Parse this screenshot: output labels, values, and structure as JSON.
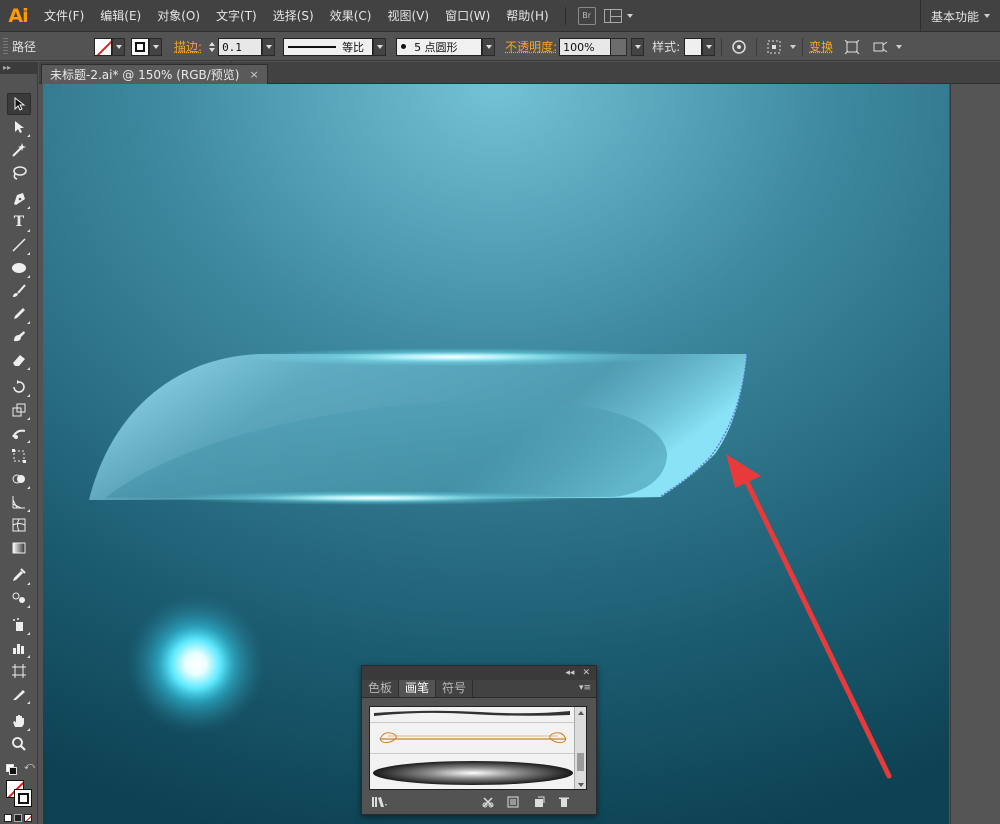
{
  "app": {
    "logo": "Ai",
    "menu": [
      "文件(F)",
      "编辑(E)",
      "对象(O)",
      "文字(T)",
      "选择(S)",
      "效果(C)",
      "视图(V)",
      "窗口(W)",
      "帮助(H)"
    ],
    "bridge_label": "Br",
    "workspace": "基本功能"
  },
  "control": {
    "object_type": "路径",
    "stroke_label": "描边:",
    "stroke_weight": "0.1 pt",
    "stroke_profile": "等比",
    "brush_def": "5 点圆形",
    "opacity_label": "不透明度:",
    "opacity_value": "100%",
    "style_label": "样式:",
    "transform_label": "变换"
  },
  "document": {
    "tab_title": "未标题-2.ai* @ 150% (RGB/预览)",
    "close_glyph": "×"
  },
  "tools": [
    "selection-tool",
    "direct-selection-tool",
    "magic-wand-tool",
    "lasso-tool",
    "pen-tool",
    "type-tool",
    "line-segment-tool",
    "ellipse-tool",
    "paintbrush-tool",
    "pencil-tool",
    "blob-brush-tool",
    "eraser-tool",
    "rotate-tool",
    "scale-tool",
    "warp-tool",
    "free-transform-tool",
    "shape-builder-tool",
    "graph-tool",
    "mesh-tool",
    "gradient-tool",
    "eyedropper-tool",
    "blend-tool",
    "symbol-sprayer-tool",
    "column-graph-tool",
    "artboard-tool",
    "slice-tool",
    "hand-tool",
    "zoom-tool"
  ],
  "brush_panel": {
    "collapse_glyph": "◂◂",
    "close_glyph": "✕",
    "tabs": [
      "色板",
      "画笔",
      "符号"
    ],
    "active_tab": "画笔",
    "menu_glyph": "▾≡"
  },
  "colors": {
    "accent_orange": "#f5a623",
    "canvas_top": "#6fc0d4",
    "canvas_bottom": "#0d3f52",
    "arrow_red": "#e83a3a",
    "glow_cyan": "#7ff3ff"
  }
}
